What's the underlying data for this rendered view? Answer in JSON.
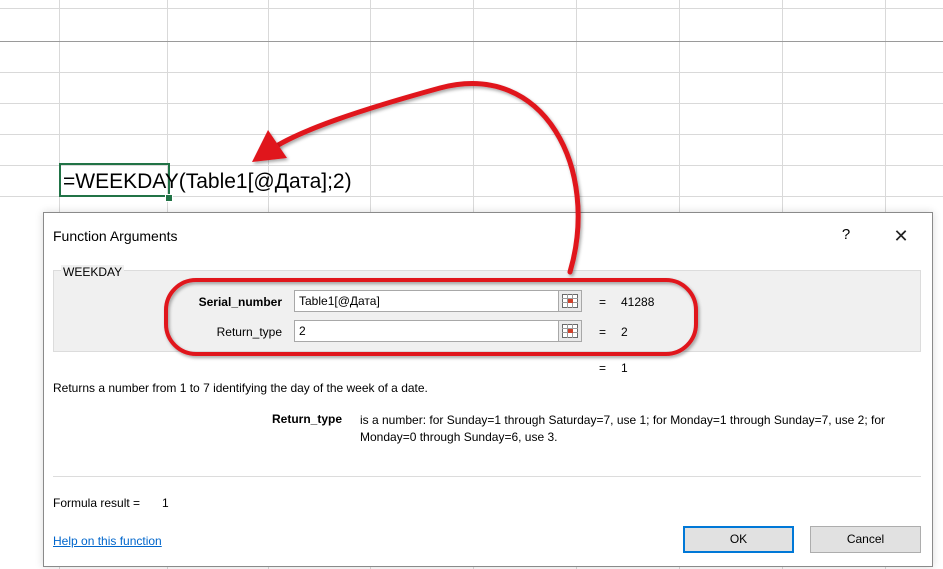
{
  "sheet": {
    "formula": "=WEEKDAY(Table1[@Дата];2)"
  },
  "dialog": {
    "title": "Function Arguments",
    "help_button": "?",
    "close_button": "✕",
    "function_name": "WEEKDAY",
    "args": [
      {
        "label": "Serial_number",
        "value": "Table1[@Дата]",
        "result": "41288"
      },
      {
        "label": "Return_type",
        "value": "2",
        "result": "2"
      }
    ],
    "overall_eq": "=",
    "overall_result": "1",
    "description": "Returns a number from 1 to 7 identifying the day of the week of a date.",
    "arg_help_label": "Return_type",
    "arg_help_text": "is a number: for Sunday=1 through Saturday=7, use 1; for Monday=1 through Sunday=7, use 2; for Monday=0 through Sunday=6, use 3.",
    "formula_result_label": "Formula result =",
    "formula_result_value": "1",
    "help_link": "Help on this function",
    "ok_label": "OK",
    "cancel_label": "Cancel"
  },
  "colors": {
    "annotation_red": "#e0141e",
    "excel_green": "#217346",
    "link_blue": "#0066cc",
    "focus_blue": "#0078d7"
  }
}
